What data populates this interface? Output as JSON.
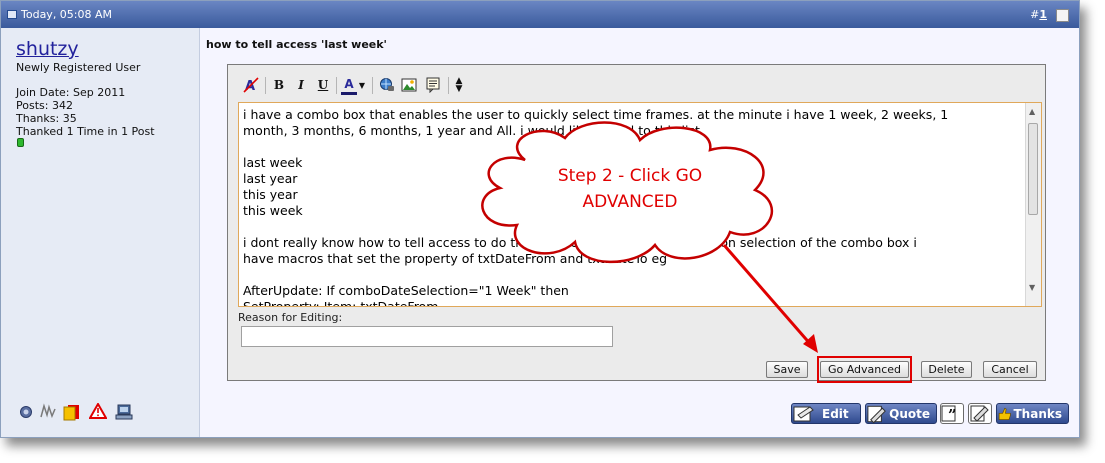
{
  "header": {
    "date": "Today, 05:08 AM",
    "post_number_prefix": "#",
    "post_number": "1"
  },
  "user": {
    "username": "shutzy",
    "user_title": "Newly Registered User",
    "join_date": "Join Date: Sep 2011",
    "posts": "Posts: 342",
    "thanks": "Thanks: 35",
    "thanked": "Thanked 1 Time in 1 Post"
  },
  "post": {
    "title": "how to tell access 'last week'"
  },
  "editor": {
    "toolbar": {
      "bold": "B",
      "italic": "I",
      "underline": "U",
      "font_color": "A"
    },
    "message": "i have a combo box that enables the user to quickly select time frames. at the minute i have 1 week, 2 weeks, 1\nmonth, 3 months, 6 months, 1 year and All. i would like to add to this list\n\nlast week\nlast year\nthis year\nthis week\n\ni dont really know how to tell access to do this. at the minute i set property. on selection of the combo box i\nhave macros that set the property of txtDateFrom and txtDateTo eg\n\nAfterUpdate: If comboDateSelection=\"1 Week\" then\nSetProperty: Item: txtDateFrom",
    "reason_label": "Reason for Editing:",
    "reason_value": "",
    "buttons": {
      "save": "Save",
      "go_advanced": "Go Advanced",
      "delete": "Delete",
      "cancel": "Cancel"
    }
  },
  "callout": {
    "line1": "Step 2 - Click GO",
    "line2": "ADVANCED"
  },
  "post_buttons": {
    "edit": "Edit",
    "quote": "Quote",
    "thanks": "Thanks"
  },
  "colors": {
    "header_bar": "#3a5a9c",
    "username": "#22229c",
    "callout_text": "#e00000",
    "highlight_border": "#e00000",
    "online_indicator": "#2eb82e"
  }
}
